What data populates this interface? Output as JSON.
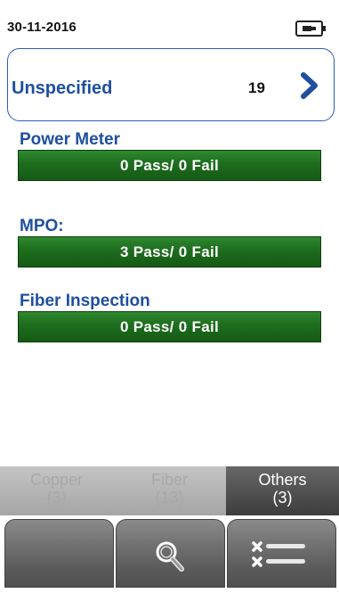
{
  "status": {
    "date": "30-11-2016",
    "battery_icon": "battery-icon"
  },
  "project": {
    "name": "Unspecified",
    "count": "19",
    "chevron_icon": "chevron-right-icon",
    "accent_color": "#1f4f9e"
  },
  "results": [
    {
      "title": "Power Meter",
      "summary": "0 Pass/ 0 Fail"
    },
    {
      "title": "MPO:",
      "summary": "3 Pass/ 0 Fail"
    },
    {
      "title": "Fiber Inspection",
      "summary": "0 Pass/ 0 Fail"
    }
  ],
  "tabs": [
    {
      "label": "Copper",
      "count": "(3)",
      "active": false
    },
    {
      "label": "Fiber",
      "count": "(13)",
      "active": false
    },
    {
      "label": "Others",
      "count": "(3)",
      "active": true
    }
  ],
  "softkeys": [
    {
      "icon": ""
    },
    {
      "icon": "magnifier-icon"
    },
    {
      "icon": "checklist-icon"
    }
  ],
  "colors": {
    "pass_bar": "#1f6e1f",
    "title_blue": "#1f4f9e",
    "active_tab": "#4f4f4f"
  }
}
